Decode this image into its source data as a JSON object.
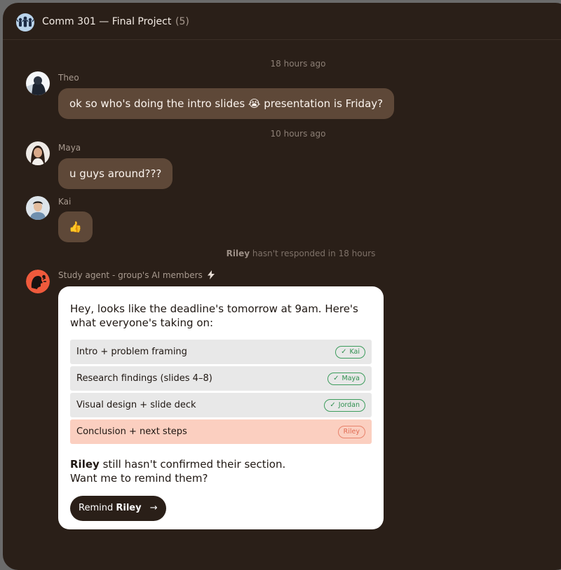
{
  "header": {
    "title": "Comm 301 — Final Project",
    "member_count": "(5)"
  },
  "messages": [
    {
      "timestamp": "18 hours ago",
      "author": "Theo",
      "text": "ok so who's doing the intro slides 😭 presentation is Friday?"
    },
    {
      "timestamp": "10 hours ago",
      "author": "Maya",
      "text": "u guys around???"
    },
    {
      "author": "Kai",
      "text": "👍"
    }
  ],
  "status_note": {
    "name": "Riley",
    "text": "hasn't responded in 18 hours"
  },
  "agent": {
    "name": "Study agent - group's AI members",
    "intro": "Hey, looks like the deadline's tomorrow at 9am. Here's what everyone's taking on:",
    "tasks": [
      {
        "label": "Intro + problem framing",
        "assignee": "Kai",
        "confirmed": true
      },
      {
        "label": "Research findings (slides 4–8)",
        "assignee": "Maya",
        "confirmed": true
      },
      {
        "label": "Visual design + slide deck",
        "assignee": "Jordan",
        "confirmed": true
      },
      {
        "label": "Conclusion + next steps",
        "assignee": "Riley",
        "confirmed": false
      }
    ],
    "followup_name": "Riley",
    "followup_line1": "still hasn't confirmed their section.",
    "followup_line2": "Want me to remind them?",
    "button_prefix": "Remind",
    "button_name": "Riley"
  },
  "colors": {
    "background": "#2a1f18",
    "bubble": "#5e4838",
    "confirmed": "#2f8f4f",
    "pending": "#e06a52",
    "agent_avatar": "#ef5a3c"
  }
}
